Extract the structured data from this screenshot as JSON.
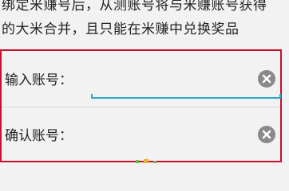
{
  "notice": {
    "line1": "绑定米赚号后，从测账号将与米赚账号获得",
    "line2": "的大米合并，且只能在米赚中兑换奖品"
  },
  "form": {
    "input_account": {
      "label": "输入账号：",
      "value": ""
    },
    "confirm_account": {
      "label": "确认账号：",
      "value": ""
    }
  },
  "colors": {
    "border": "#c8102e",
    "focus_underline": "#2aa7c9",
    "clear_button": "#8a8a8a"
  },
  "icons": {
    "clear": "clear-icon"
  }
}
